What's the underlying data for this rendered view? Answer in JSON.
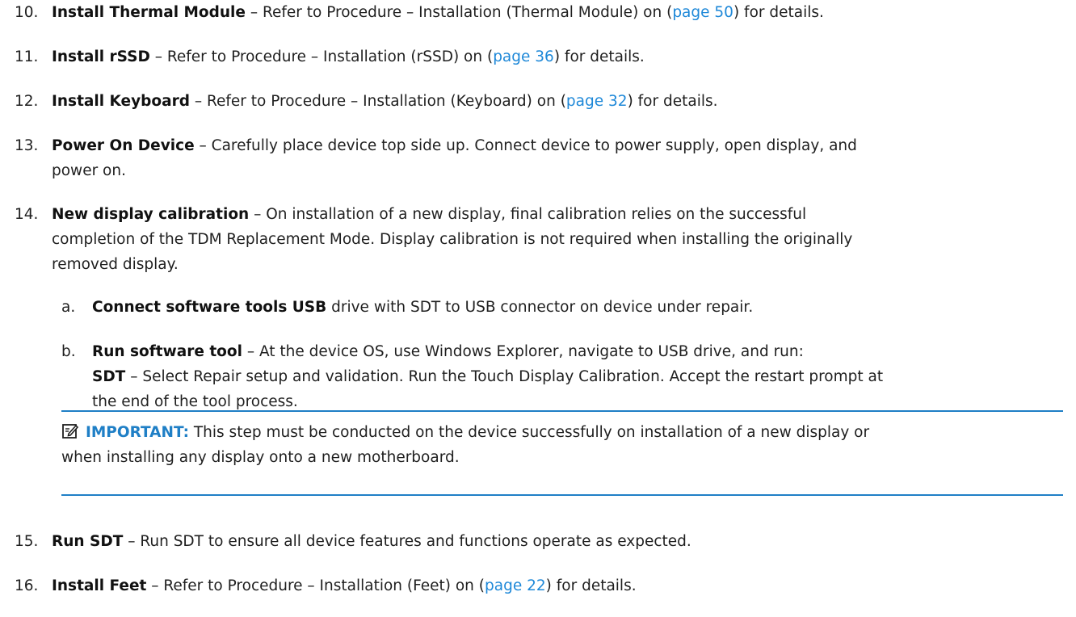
{
  "steps": {
    "s10": {
      "number": "10.",
      "title": "Install Thermal Module",
      "text": " – Refer to Procedure – Installation (Thermal Module) on (",
      "link": "page 50",
      "after": ") for details."
    },
    "s11": {
      "number": "11.",
      "title": "Install rSSD",
      "text": " – Refer to Procedure – Installation (rSSD) on (",
      "link": "page 36",
      "after": ") for details."
    },
    "s12": {
      "number": "12.",
      "title": "Install Keyboard",
      "text": " – Refer to Procedure – Installation (Keyboard) on (",
      "link": "page 32",
      "after": ") for details."
    },
    "s13": {
      "number": "13.",
      "title": "Power On Device",
      "line1": " – Carefully place device top side up. Connect device to power supply, open display, and",
      "line2": "power on."
    },
    "s14": {
      "number": "14.",
      "title": "New display calibration",
      "line1": " – On installation of a new display, final calibration relies on the successful",
      "line2": "completion of the TDM Replacement Mode. Display calibration is not required when installing the originally",
      "line3": "removed display.",
      "sub_a": {
        "letter": "a.",
        "title": "Connect software tools USB",
        "text": " drive with SDT to USB connector on device under repair."
      },
      "sub_b": {
        "letter": "b.",
        "title": "Run software tool",
        "line1": " – At the device OS, use Windows Explorer, navigate to USB drive, and run:",
        "sdt_label": "SDT",
        "line2": " – Select Repair setup and validation. Run the Touch Display Calibration. Accept the restart prompt at",
        "line3": "the end of the tool process."
      },
      "note": {
        "icon": "note-edit-icon",
        "label": "IMPORTANT:",
        "line1": " This step must be conducted on the device successfully on installation of a new display or",
        "line2": "when installing any display onto a new motherboard."
      }
    },
    "s15": {
      "number": "15.",
      "title": "Run SDT",
      "text": " – Run SDT to ensure all device features and functions operate as expected."
    },
    "s16": {
      "number": "16.",
      "title": "Install Feet",
      "text": " – Refer to Procedure – Installation (Feet) on (",
      "link": "page 22",
      "after": ") for details."
    }
  },
  "colors": {
    "link": "#1e88d8",
    "accent": "#1f7fc6"
  }
}
